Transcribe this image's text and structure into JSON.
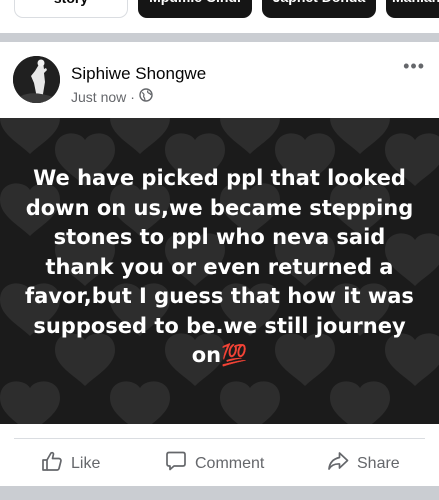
{
  "stories": {
    "create_label": "story",
    "names": [
      "Mpumie Cindi",
      "Japhet Donda",
      "Mahlan"
    ]
  },
  "post": {
    "author": "Siphiwe Shongwe",
    "timestamp": "Just now",
    "separator": "·",
    "privacy_icon": "globe-icon",
    "more_icon": "more-dots-icon",
    "more_label": "•••",
    "text": "We have picked ppl that looked down on us,we became stepping stones to ppl who neva said thank you or even returned a favor,but I guess that how it was supposed to be.we still journey on",
    "emoji": "💯"
  },
  "actions": {
    "like": "Like",
    "comment": "Comment",
    "share": "Share"
  },
  "colors": {
    "accent": "#65676b",
    "image_bg": "#1b1b1b",
    "hundred_emoji": "#e0245e"
  }
}
